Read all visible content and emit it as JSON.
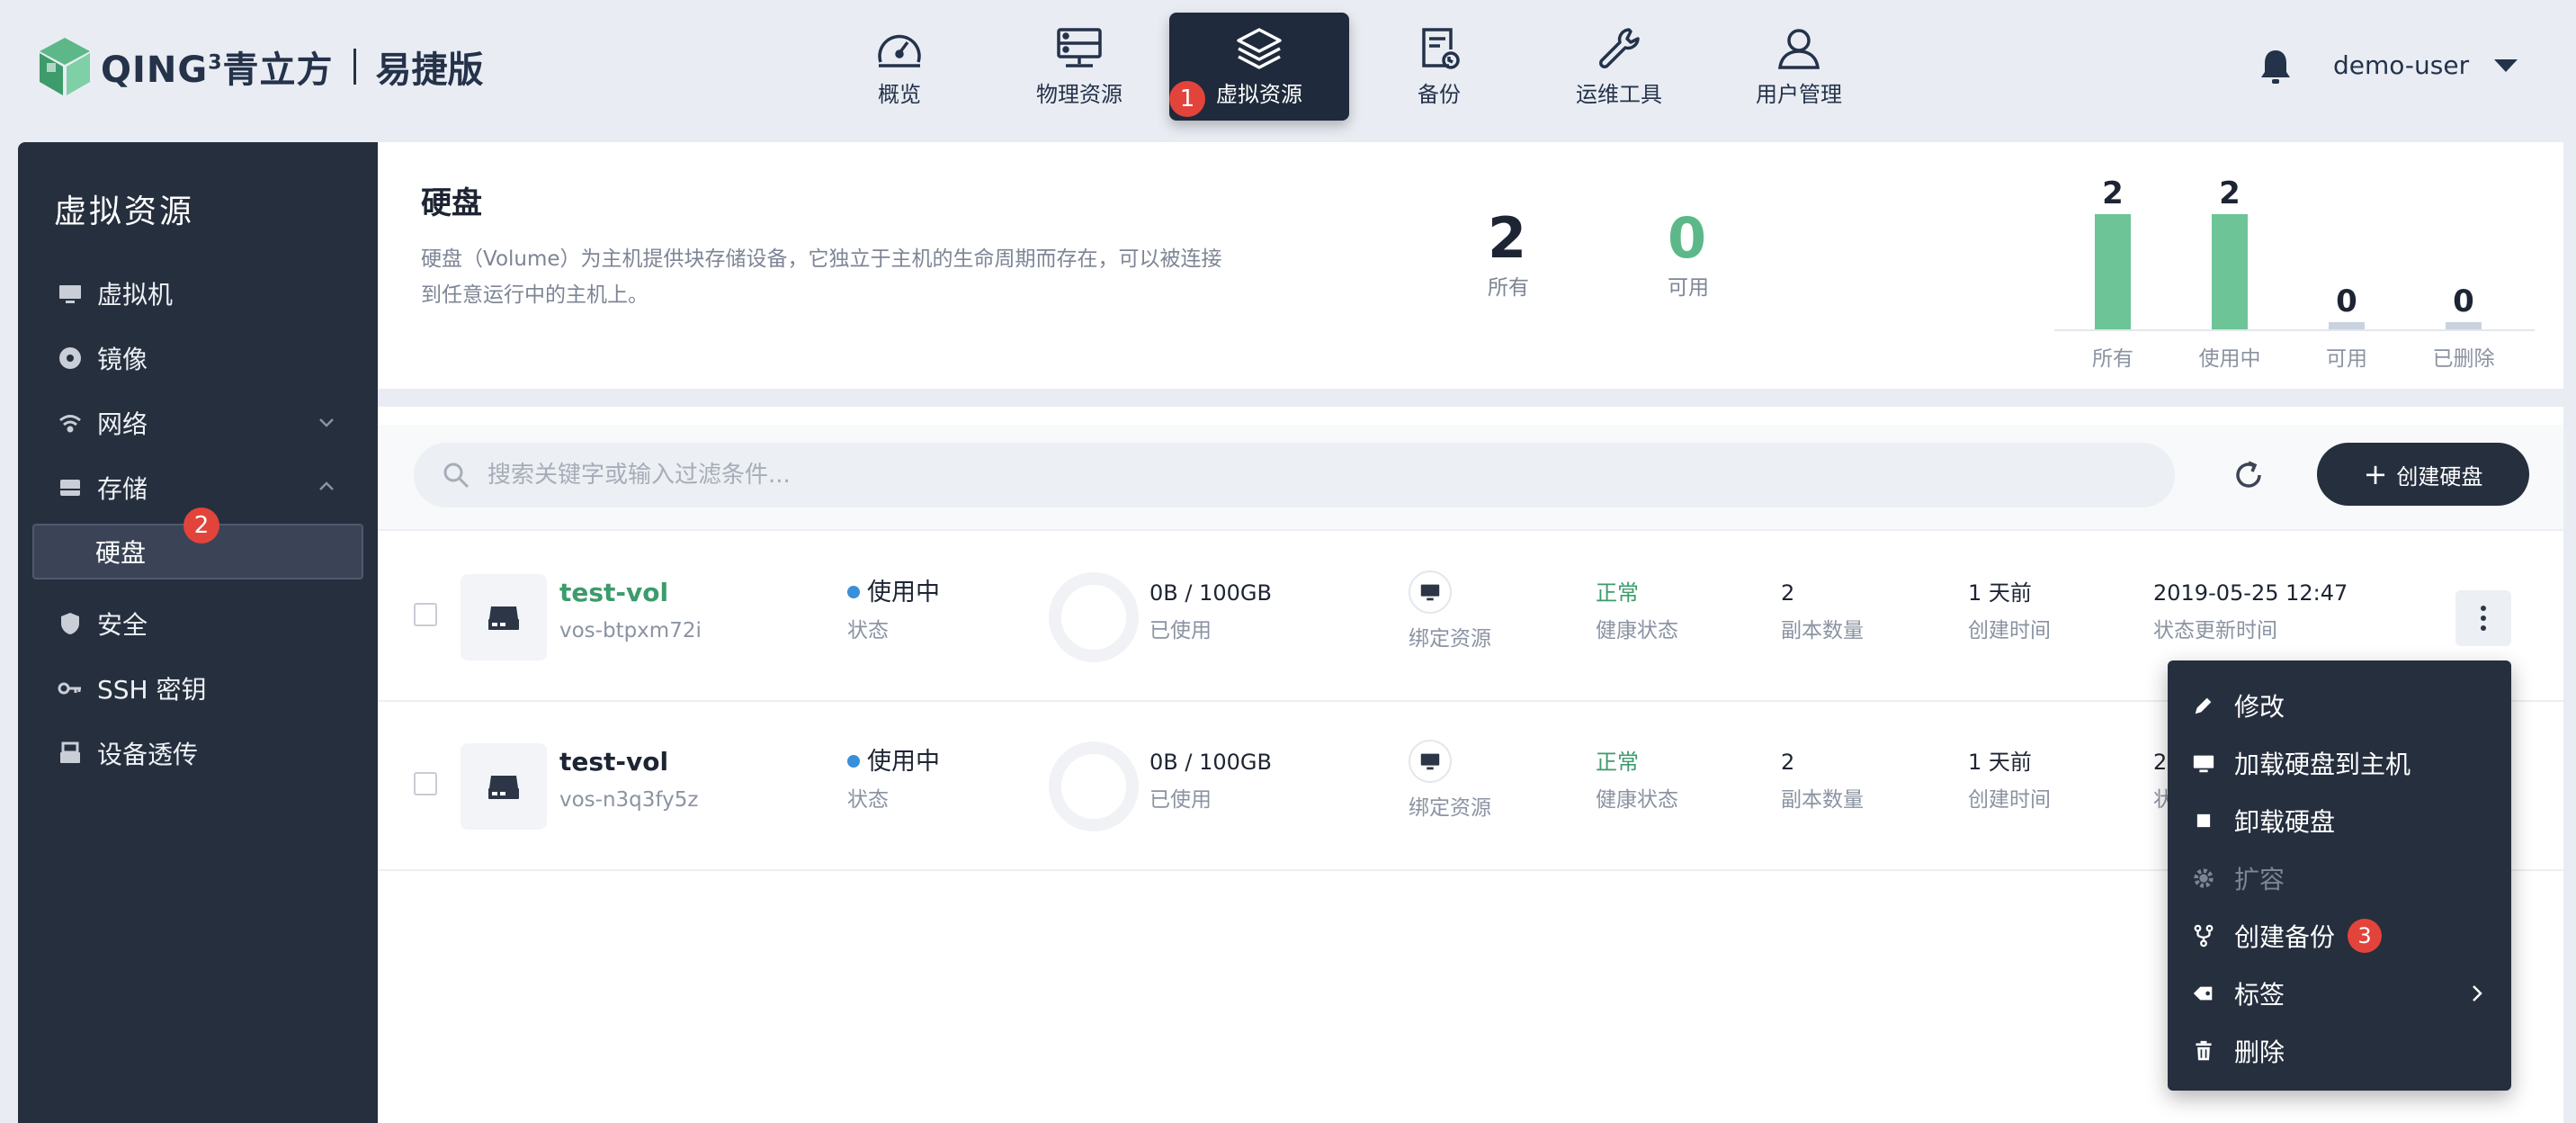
{
  "brand": {
    "name": "QING",
    "sup": "3",
    "cn": "青立方",
    "edition": "易捷版"
  },
  "nav": [
    {
      "label": "概览",
      "icon": "dashboard-icon"
    },
    {
      "label": "物理资源",
      "icon": "server-icon"
    },
    {
      "label": "虚拟资源",
      "icon": "layers-icon",
      "active": true
    },
    {
      "label": "备份",
      "icon": "backup-icon"
    },
    {
      "label": "运维工具",
      "icon": "wrench-icon"
    },
    {
      "label": "用户管理",
      "icon": "user-icon"
    }
  ],
  "badges": {
    "nav": "1",
    "sidebar": "2",
    "menu": "3"
  },
  "user": {
    "name": "demo-user"
  },
  "sidebar": {
    "title": "虚拟资源",
    "items": [
      {
        "label": "虚拟机",
        "icon": "monitor-icon"
      },
      {
        "label": "镜像",
        "icon": "disc-icon"
      },
      {
        "label": "网络",
        "icon": "wifi-icon"
      },
      {
        "label": "存储",
        "icon": "storage-icon"
      },
      {
        "label": "硬盘",
        "icon": ""
      },
      {
        "label": "安全",
        "icon": "shield-icon"
      },
      {
        "label": "SSH 密钥",
        "icon": "key-icon"
      },
      {
        "label": "设备透传",
        "icon": "device-icon"
      }
    ]
  },
  "summary": {
    "title": "硬盘",
    "description": "硬盘（Volume）为主机提供块存储设备，它独立于主机的生命周期而存在，可以被连接到任意运行中的主机上。",
    "stats": [
      {
        "value": "2",
        "label": "所有"
      },
      {
        "value": "0",
        "label": "可用"
      }
    ]
  },
  "chart_data": {
    "type": "bar",
    "categories": [
      "所有",
      "使用中",
      "可用",
      "已删除"
    ],
    "values": [
      2,
      2,
      0,
      0
    ],
    "colors": [
      "#6cc497",
      "#6cc497",
      "#c9d3df",
      "#c9d3df"
    ]
  },
  "toolbar": {
    "search_placeholder": "搜索关键字或输入过滤条件...",
    "create_label": "创建硬盘",
    "create_plus": "+"
  },
  "rows": [
    {
      "name": "test-vol",
      "id": "vos-btpxm72i",
      "status": "使用中",
      "status_label": "状态",
      "usage": "0B / 100GB",
      "usage_label": "已使用",
      "bind_label": "绑定资源",
      "health": "正常",
      "health_label": "健康状态",
      "replicas": "2",
      "replicas_label": "副本数量",
      "created": "1 天前",
      "created_label": "创建时间",
      "updated": "2019-05-25 12:47",
      "updated_label": "状态更新时间"
    },
    {
      "name": "test-vol",
      "id": "vos-n3q3fy5z",
      "status": "使用中",
      "status_label": "状态",
      "usage": "0B / 100GB",
      "usage_label": "已使用",
      "bind_label": "绑定资源",
      "health": "正常",
      "health_label": "健康状态",
      "replicas": "2",
      "replicas_label": "副本数量",
      "created": "1 天前",
      "created_label": "创建时间",
      "updated": "2",
      "updated_label": "状"
    }
  ],
  "menu": [
    {
      "label": "修改",
      "icon": "pencil-icon"
    },
    {
      "label": "加载硬盘到主机",
      "icon": "monitor-icon"
    },
    {
      "label": "卸载硬盘",
      "icon": "square-icon"
    },
    {
      "label": "扩容",
      "icon": "gear-icon",
      "disabled": true
    },
    {
      "label": "创建备份",
      "icon": "fork-icon"
    },
    {
      "label": "标签",
      "icon": "tag-icon"
    },
    {
      "label": "删除",
      "icon": "trash-icon"
    }
  ]
}
